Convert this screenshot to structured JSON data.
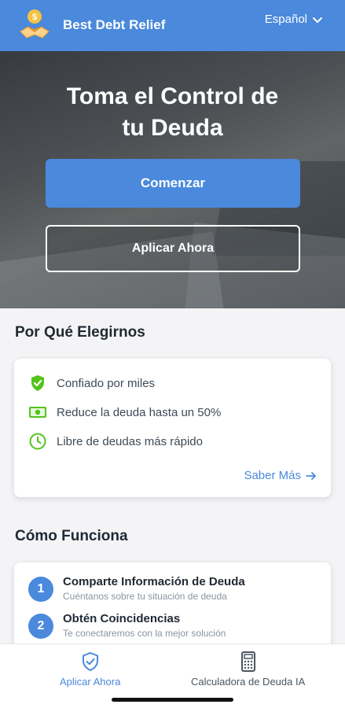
{
  "header": {
    "brand": "Best Debt Relief",
    "language": "Español",
    "icons": {
      "logo": "handshake-coin-logo",
      "language_toggle": "chevron-down-icon"
    }
  },
  "hero": {
    "title_line1": "Toma el Control de",
    "title_line2": "tu Deuda",
    "primary_button": "Comenzar",
    "secondary_button": "Aplicar Ahora"
  },
  "why": {
    "title": "Por Qué Elegirnos",
    "features": [
      {
        "label": "Confiado por miles",
        "icon": "shield-check-icon"
      },
      {
        "label": "Reduce la deuda hasta un 50%",
        "icon": "money-icon"
      },
      {
        "label": "Libre de deudas más rápido",
        "icon": "clock-icon"
      }
    ],
    "learn_more": "Saber Más"
  },
  "how": {
    "title": "Cómo Funciona",
    "steps": [
      {
        "number": "1",
        "title": "Comparte Información de Deuda",
        "subtitle": "Cuéntanos sobre tu situación de deuda"
      },
      {
        "number": "2",
        "title": "Obtén Coincidencias",
        "subtitle": "Te conectaremos con la mejor solución"
      }
    ]
  },
  "bottom_nav": {
    "items": [
      {
        "label": "Aplicar Ahora",
        "icon": "shield-check-icon",
        "active": true
      },
      {
        "label": "Calculadora de Deuda IA",
        "icon": "calculator-icon",
        "active": false
      }
    ]
  },
  "colors": {
    "accent": "#4a89dc",
    "feature_green": "#52c41a"
  }
}
